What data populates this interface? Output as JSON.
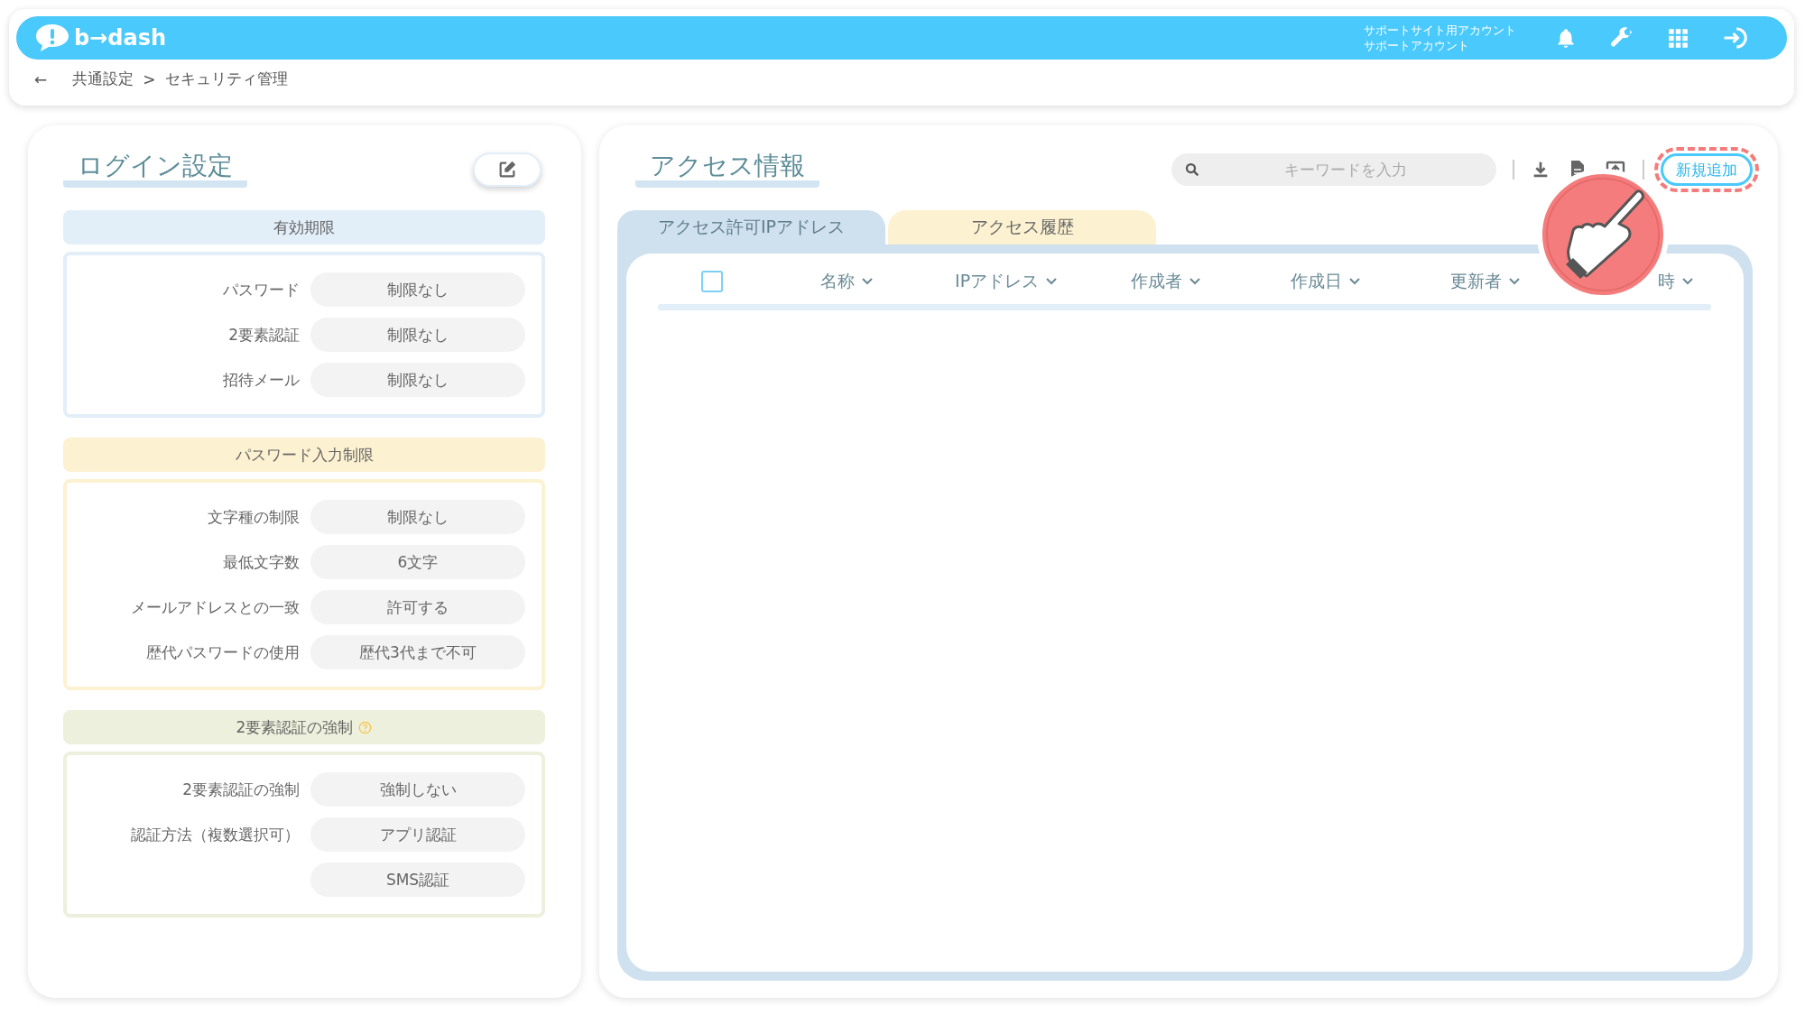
{
  "header": {
    "logo": "b→dash",
    "account_lines": [
      "サポートサイト用アカウント",
      "サポートアカウント"
    ]
  },
  "breadcrumb": {
    "back": "←",
    "items": [
      "共通設定",
      "セキュリティ管理"
    ],
    "separator": ">"
  },
  "login_settings": {
    "title": "ログイン設定",
    "sections": [
      {
        "kind": "blue",
        "title": "有効期限",
        "help": false,
        "rows": [
          {
            "label": "パスワード",
            "value": "制限なし"
          },
          {
            "label": "2要素認証",
            "value": "制限なし"
          },
          {
            "label": "招待メール",
            "value": "制限なし"
          }
        ]
      },
      {
        "kind": "yellow",
        "title": "パスワード入力制限",
        "help": false,
        "rows": [
          {
            "label": "文字種の制限",
            "value": "制限なし"
          },
          {
            "label": "最低文字数",
            "value": "6文字"
          },
          {
            "label": "メールアドレスとの一致",
            "value": "許可する"
          },
          {
            "label": "歴代パスワードの使用",
            "value": "歴代3代まで不可"
          }
        ]
      },
      {
        "kind": "green",
        "title": "2要素認証の強制",
        "help": true,
        "rows": [
          {
            "label": "2要素認証の強制",
            "value": "強制しない"
          },
          {
            "label": "認証方法（複数選択可）",
            "value": "アプリ認証"
          },
          {
            "value": "SMS認証"
          }
        ]
      }
    ]
  },
  "access_info": {
    "title": "アクセス情報",
    "search": {
      "placeholder": "キーワードを入力"
    },
    "add_button": "新規追加",
    "add_highlighted": true,
    "tabs": [
      {
        "label": "アクセス許可IPアドレス",
        "selected": true
      },
      {
        "label": "アクセス履歴",
        "selected": false
      }
    ],
    "table": {
      "select_all_checked": false,
      "columns": [
        "名称",
        "IPアドレス",
        "作成者",
        "作成日",
        "更新者",
        "時"
      ]
    }
  }
}
